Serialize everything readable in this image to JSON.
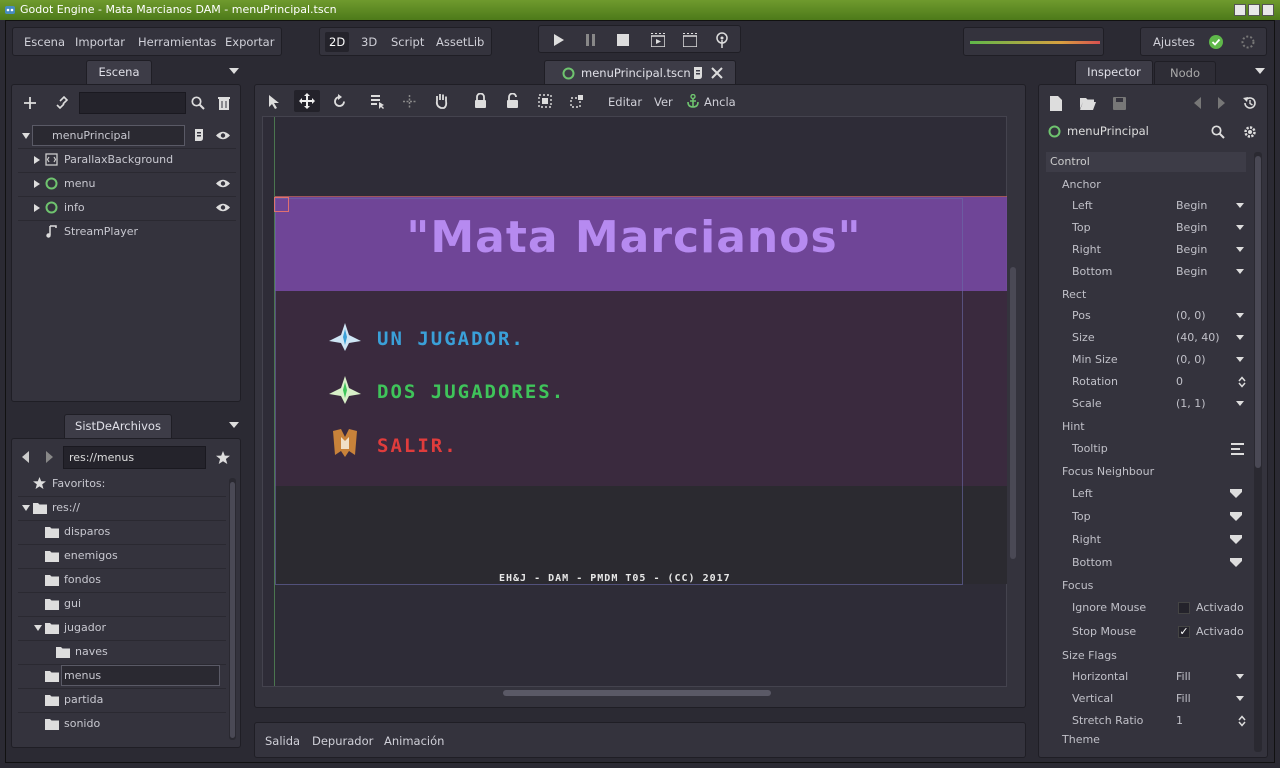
{
  "window": {
    "title": "Godot Engine - Mata Marcianos DAM - menuPrincipal.tscn"
  },
  "menubar": {
    "items": [
      "Escena",
      "Importar",
      "Herramientas",
      "Exportar"
    ]
  },
  "workspaces": [
    "2D",
    "3D",
    "Script",
    "AssetLib"
  ],
  "settings_label": "Ajustes",
  "colors": {
    "accent": "#6fc46f",
    "bg": "#2b2a33",
    "panel": "#34333d",
    "banner": "#7a4aa8",
    "title_text": "#b68af0"
  },
  "scene_dock": {
    "tab": "Escena",
    "nodes": [
      {
        "name": "menuPrincipal",
        "icon": "control-icon",
        "has_script": true,
        "visible": true
      },
      {
        "name": "ParallaxBackground",
        "icon": "parallax-icon",
        "visible": false
      },
      {
        "name": "menu",
        "icon": "control-icon",
        "visible": true
      },
      {
        "name": "info",
        "icon": "control-icon",
        "visible": true
      },
      {
        "name": "StreamPlayer",
        "icon": "audio-icon",
        "visible": false
      }
    ]
  },
  "filesystem_dock": {
    "tab": "SistDeArchivos",
    "path": "res://menus",
    "favorites_label": "Favoritos:",
    "root": "res://",
    "folders": [
      "disparos",
      "enemigos",
      "fondos",
      "gui",
      "jugador",
      "naves",
      "menus",
      "partida",
      "sonido"
    ],
    "selected": "menus"
  },
  "editor_tab": "menuPrincipal.tscn",
  "toolbar": {
    "edit_label": "Editar",
    "view_label": "Ver",
    "anchor_label": "Ancla"
  },
  "game": {
    "title": "\"Mata Marcianos\"",
    "options": [
      {
        "label": "UN JUGADOR.",
        "color": "#3aa0d8"
      },
      {
        "label": "DOS JUGADORES.",
        "color": "#3fc45a"
      },
      {
        "label": "SALIR.",
        "color": "#e03c3c"
      }
    ],
    "footer": "EH&J - DAM - PMDM T05 - (CC) 2017"
  },
  "bottom_panel": {
    "tabs": [
      "Salida",
      "Depurador",
      "Animación"
    ]
  },
  "inspector": {
    "tabs": [
      "Inspector",
      "Nodo"
    ],
    "node": "menuPrincipal",
    "class_header": "Control",
    "anchor_label": "Anchor",
    "anchor": [
      {
        "label": "Left",
        "value": "Begin"
      },
      {
        "label": "Top",
        "value": "Begin"
      },
      {
        "label": "Right",
        "value": "Begin"
      },
      {
        "label": "Bottom",
        "value": "Begin"
      }
    ],
    "rect_label": "Rect",
    "rect": [
      {
        "label": "Pos",
        "value": "(0, 0)"
      },
      {
        "label": "Size",
        "value": "(40, 40)"
      },
      {
        "label": "Min Size",
        "value": "(0, 0)"
      },
      {
        "label": "Rotation",
        "value": "0"
      },
      {
        "label": "Scale",
        "value": "(1, 1)"
      }
    ],
    "hint_label": "Hint",
    "tooltip_label": "Tooltip",
    "focus_neighbour_label": "Focus Neighbour",
    "focus_neighbour": [
      "Left",
      "Top",
      "Right",
      "Bottom"
    ],
    "focus_label": "Focus",
    "focus": [
      {
        "label": "Ignore Mouse",
        "value": "Activado",
        "checked": false
      },
      {
        "label": "Stop Mouse",
        "value": "Activado",
        "checked": true
      }
    ],
    "size_flags_label": "Size Flags",
    "size_flags": [
      {
        "label": "Horizontal",
        "value": "Fill"
      },
      {
        "label": "Vertical",
        "value": "Fill"
      },
      {
        "label": "Stretch Ratio",
        "value": "1"
      }
    ],
    "theme_label": "Theme"
  }
}
